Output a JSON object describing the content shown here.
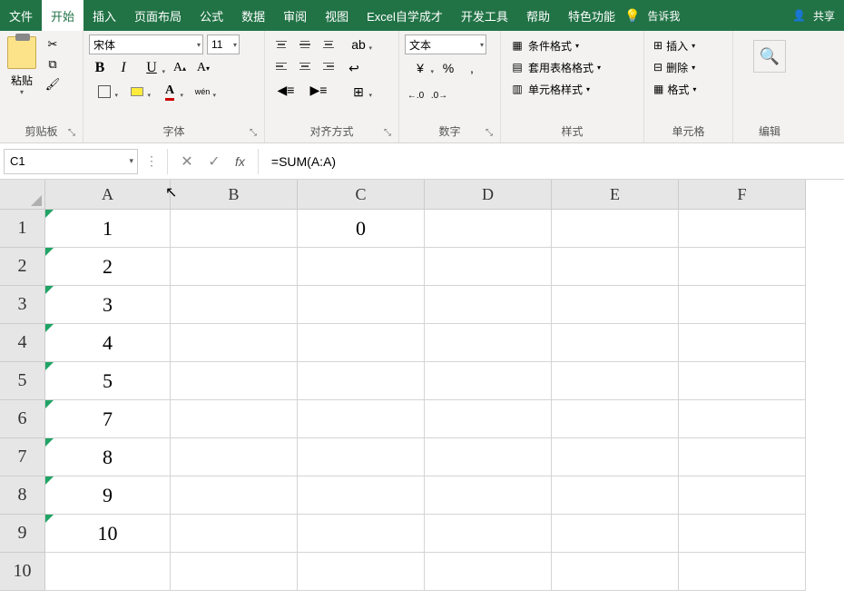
{
  "menu": {
    "items": [
      "文件",
      "开始",
      "插入",
      "页面布局",
      "公式",
      "数据",
      "审阅",
      "视图",
      "Excel自学成才",
      "开发工具",
      "帮助",
      "特色功能"
    ],
    "active_index": 1,
    "tell_me": "告诉我",
    "share": "共享"
  },
  "ribbon": {
    "clipboard": {
      "label": "剪贴板",
      "paste": "粘贴"
    },
    "font": {
      "label": "字体",
      "name": "宋体",
      "size": "11",
      "wen": "wén"
    },
    "alignment": {
      "label": "对齐方式"
    },
    "number": {
      "label": "数字",
      "format": "文本"
    },
    "styles": {
      "label": "样式",
      "conditional": "条件格式",
      "table": "套用表格格式",
      "cell": "单元格样式"
    },
    "cells": {
      "label": "单元格",
      "insert": "插入",
      "delete": "删除",
      "format": "格式"
    },
    "editing": {
      "label": "编辑"
    }
  },
  "formula_bar": {
    "name_box": "C1",
    "formula": "=SUM(A:A)",
    "fx": "fx"
  },
  "grid": {
    "columns": [
      "A",
      "B",
      "C",
      "D",
      "E",
      "F"
    ],
    "rows": [
      {
        "num": "1",
        "A": "1",
        "C": "0"
      },
      {
        "num": "2",
        "A": "2"
      },
      {
        "num": "3",
        "A": "3"
      },
      {
        "num": "4",
        "A": "4"
      },
      {
        "num": "5",
        "A": "5"
      },
      {
        "num": "6",
        "A": "7"
      },
      {
        "num": "7",
        "A": "8"
      },
      {
        "num": "8",
        "A": "9"
      },
      {
        "num": "9",
        "A": "10"
      },
      {
        "num": "10",
        "A": ""
      }
    ]
  }
}
